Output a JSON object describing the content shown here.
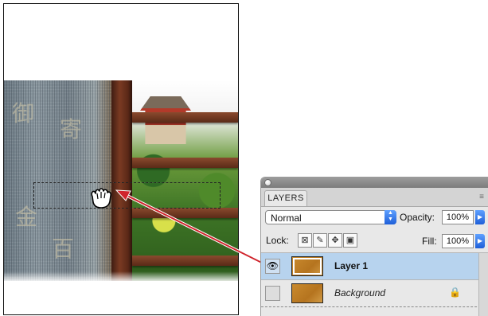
{
  "canvas": {
    "stone_glyphs": [
      "御",
      "寄",
      "金",
      "百"
    ]
  },
  "layers_panel": {
    "tab_label": "LAYERS",
    "menu_icon": "≡",
    "blend_mode": "Normal",
    "opacity_label": "Opacity:",
    "opacity_value": "100%",
    "lock_label": "Lock:",
    "fill_label": "Fill:",
    "fill_value": "100%",
    "layers": [
      {
        "name": "Layer 1",
        "visible": true,
        "selected": true
      },
      {
        "name": "Background",
        "visible": false,
        "selected": false,
        "locked": true
      }
    ]
  },
  "colors": {
    "selection_highlight": "#b7d3ee",
    "arrow": "#d0242c",
    "accent_blue": "#1e5fd8"
  }
}
